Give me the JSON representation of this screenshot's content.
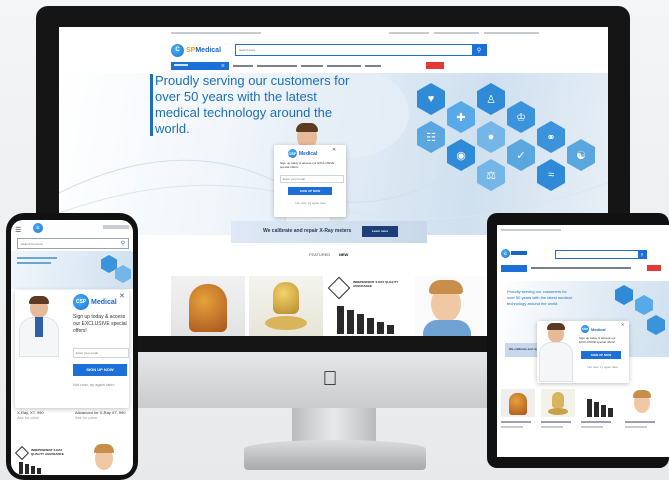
{
  "imac": {
    "logo": {
      "mark": "C",
      "name_a": "SP",
      "name_b": "Medical"
    },
    "search_placeholder": "Search here",
    "hero_text": "Proudly serving our customers for over 50 years with the latest medical technology around the world.",
    "popup": {
      "logo_a": "CSP",
      "logo_b": "Medical",
      "headline": "Sign up today & access our EXCLUSIVE special offers!",
      "field_placeholder": "Enter your email",
      "button": "SIGN UP NOW",
      "footer": "Not now, try again later."
    },
    "banner": {
      "text": "We calibrate and repair X-Ray meters",
      "button": "Learn more"
    },
    "tabs": [
      "FEATURED",
      "NEW"
    ],
    "product_badge": {
      "title": "INDEPENDENT X-RAY QUALITY ASSURANCE"
    },
    "flag_color": "#e53935",
    "accent": "#1d6fd8"
  },
  "phone": {
    "search_placeholder": "Search for items",
    "popup": {
      "logo_a": "CSP",
      "logo_b": "Medical",
      "headline": "Sign up today & access our EXCLUSIVE special offers!",
      "field_placeholder": "Enter your email",
      "button": "SIGN UP NOW",
      "footer": "Not now, try again later."
    },
    "products": [
      {
        "name": "X-Ray, XT, 990",
        "price": "Ask for price"
      },
      {
        "name": "Advanced for X-Ray XT, 990",
        "price": "Ask for price"
      }
    ],
    "badge": "INDEPENDENT X-RAY QUALITY ASSURANCE"
  },
  "tablet": {
    "hero_text": "Proudly serving our customers for over 50 years with the latest medical technology around the world.",
    "popup": {
      "logo_a": "CSP",
      "logo_b": "Medical",
      "headline": "Sign up today & access our EXCLUSIVE special offers!",
      "button": "SIGN UP NOW",
      "footer": "Not now, try again later."
    },
    "banner_text": "We calibrate and repair X-Ray meters"
  }
}
